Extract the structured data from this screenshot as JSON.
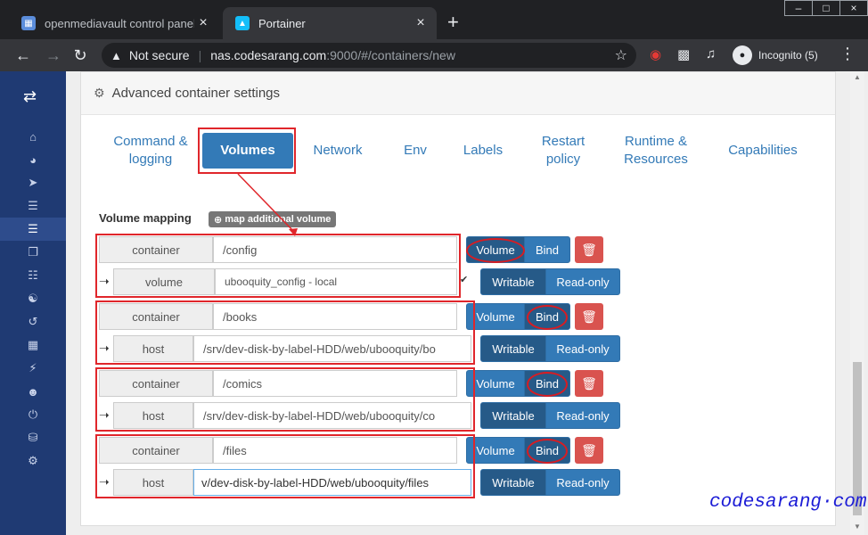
{
  "browser": {
    "tabs": [
      {
        "title": "openmediavault control panel - •",
        "icon": "omv-icon"
      },
      {
        "title": "Portainer",
        "icon": "portainer-icon"
      }
    ],
    "address": {
      "security": "Not secure",
      "host": "nas.codesarang.com",
      "path": ":9000/#/containers/new"
    },
    "incognito_label": "Incognito (5)"
  },
  "panel": {
    "title": "Advanced container settings"
  },
  "tabs": [
    {
      "label": "Command & logging"
    },
    {
      "label": "Volumes"
    },
    {
      "label": "Network"
    },
    {
      "label": "Env"
    },
    {
      "label": "Labels"
    },
    {
      "label": "Restart policy"
    },
    {
      "label": "Runtime & Resources"
    },
    {
      "label": "Capabilities"
    }
  ],
  "volume_mapping": {
    "title": "Volume mapping",
    "add_button": "map additional volume",
    "mappings": [
      {
        "container_label": "container",
        "container_path": "/config",
        "mode_volume": "Volume",
        "mode_bind": "Bind",
        "source_label": "volume",
        "source_value": "ubooquity_config - local",
        "writable": "Writable",
        "readonly": "Read-only"
      },
      {
        "container_label": "container",
        "container_path": "/books",
        "mode_volume": "Volume",
        "mode_bind": "Bind",
        "source_label": "host",
        "source_value": "/srv/dev-disk-by-label-HDD/web/ubooquity/bo",
        "writable": "Writable",
        "readonly": "Read-only"
      },
      {
        "container_label": "container",
        "container_path": "/comics",
        "mode_volume": "Volume",
        "mode_bind": "Bind",
        "source_label": "host",
        "source_value": "/srv/dev-disk-by-label-HDD/web/ubooquity/co",
        "writable": "Writable",
        "readonly": "Read-only"
      },
      {
        "container_label": "container",
        "container_path": "/files",
        "mode_volume": "Volume",
        "mode_bind": "Bind",
        "source_label": "host",
        "source_value": "v/dev-disk-by-label-HDD/web/ubooquity/files",
        "writable": "Writable",
        "readonly": "Read-only"
      }
    ]
  },
  "watermark": "codesarang·com",
  "colors": {
    "primary": "#337ab7",
    "danger": "#d9534f",
    "sidebar": "#1f3a73",
    "annotation": "#e0262b"
  }
}
